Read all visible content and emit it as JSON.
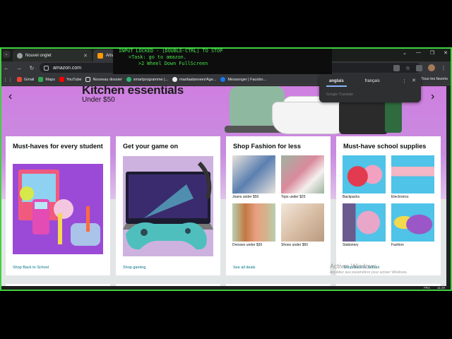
{
  "browser": {
    "tabs": [
      {
        "label": "Nouvel onglet",
        "favicon_color": "#9aa0a6"
      },
      {
        "label": "Amaz",
        "favicon_color": "#ff9900"
      }
    ],
    "url": "amazon.com",
    "bookmarks": [
      {
        "label": "Gmail",
        "color": "#ea4335"
      },
      {
        "label": "Maps",
        "color": "#34a853"
      },
      {
        "label": "YouTube",
        "color": "#ff0000"
      },
      {
        "label": "Nouveau dossier",
        "color": "#e8eaed"
      },
      {
        "label": "smartprogramme |...",
        "color": "#2bb673"
      },
      {
        "label": "masfaatanveer/Age...",
        "color": "#f0f0f0"
      },
      {
        "label": "Messenger | Facebo...",
        "color": "#1877f2"
      }
    ],
    "bookmarks_right": "Tous les favoris"
  },
  "overlay": {
    "line1": "INPUT LOCKED  - [DOUBLE-CTRL] TO STOP",
    "line2": ">Task: go to amazon.",
    "line3": ">2 Wheel Down FullScreen"
  },
  "translate_popup": {
    "tab_active": "anglais",
    "tab_other": "français",
    "powered_by": "Google Translate"
  },
  "hero": {
    "title": "Kitchen essentials",
    "subtitle": "Under $50"
  },
  "cards": [
    {
      "title": "Must-haves for every student",
      "link": "Shop Back to School"
    },
    {
      "title": "Get your game on",
      "link": "Shop gaming"
    },
    {
      "title": "Shop Fashion for less",
      "link": "See all deals",
      "items": [
        {
          "label": "Jeans under $50",
          "color": "#5a7fb0"
        },
        {
          "label": "Tops under $25",
          "color": "#d98a9c"
        },
        {
          "label": "Dresses under $30",
          "color": "#c27842"
        },
        {
          "label": "Shoes under $50",
          "color": "#d9bfa6"
        }
      ]
    },
    {
      "title": "Must-have school supplies",
      "link": "Shop Back to School",
      "items": [
        {
          "label": "Backpacks",
          "color": "#4fc3e8"
        },
        {
          "label": "Electronics",
          "color": "#f5b6c6"
        },
        {
          "label": "Stationery",
          "color": "#6b5a8e"
        },
        {
          "label": "Fashion",
          "color": "#9b57c7"
        }
      ]
    }
  ],
  "watermark": {
    "line1": "Activer Windows",
    "line2": "Accédez aux paramètres pour activer Windows."
  },
  "taskbar": {
    "lang": "FRA",
    "time": "11:29"
  }
}
